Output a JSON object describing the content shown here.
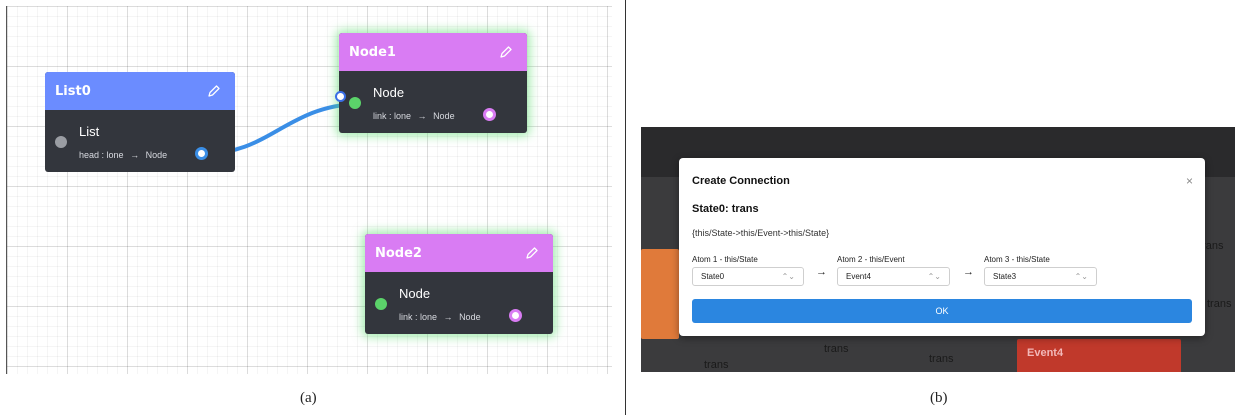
{
  "panel_a": {
    "nodes": {
      "list0": {
        "title": "List0",
        "type": "List",
        "field_name": "head : lone",
        "field_arrow": "→",
        "field_target": "Node"
      },
      "node1": {
        "title": "Node1",
        "type": "Node",
        "field_name": "link : lone",
        "field_arrow": "→",
        "field_target": "Node"
      },
      "node2": {
        "title": "Node2",
        "type": "Node",
        "field_name": "link : lone",
        "field_arrow": "→",
        "field_target": "Node"
      }
    },
    "caption": "(a)"
  },
  "panel_b": {
    "background_labels": [
      "trans",
      "trans",
      "trans",
      "trans",
      "trans"
    ],
    "background_card": "Event4",
    "dialog": {
      "title": "Create Connection",
      "close": "×",
      "subtitle": "State0: trans",
      "expression": "{this/State->this/Event->this/State}",
      "atoms": [
        {
          "label": "Atom 1 - this/State",
          "value": "State0"
        },
        {
          "label": "Atom 2 - this/Event",
          "value": "Event4"
        },
        {
          "label": "Atom 3 - this/State",
          "value": "State3"
        }
      ],
      "arrow": "→",
      "select_chevron": "⌃⌄",
      "ok_label": "OK"
    },
    "caption": "(b)"
  },
  "icons": {
    "edit": "pencil-icon",
    "close": "close-icon"
  },
  "colors": {
    "list_header": "#6b8cff",
    "node_header": "#d97cf3",
    "node_body": "#33363d",
    "edge": "#3a8ee6",
    "ok_button": "#2b86e0",
    "glow": "#5bd36a"
  }
}
